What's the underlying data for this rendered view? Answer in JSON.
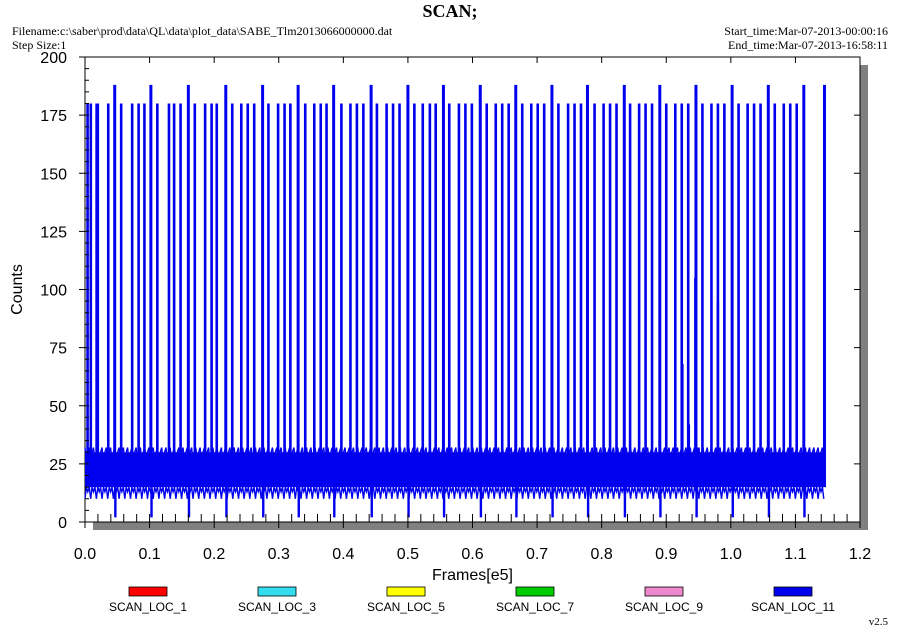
{
  "header": {
    "title": "SCAN;",
    "filename": "Filename:c:\\saber\\prod\\data\\QL\\data\\plot_data\\SABE_Tlm2013066000000.dat",
    "step_size": "Step Size:1",
    "start_time": "Start_time:Mar-07-2013-00:00:16",
    "end_time": "End_time:Mar-07-2013-16:58:11"
  },
  "footer": {
    "version": "v2.5"
  },
  "colors": {
    "plot_background": "#ffffff",
    "shadow": "#808080",
    "frame": "#000000",
    "primary_series": "#0000ee"
  },
  "chart_data": {
    "type": "line",
    "title": "SCAN;",
    "xlabel": "Frames[e5]",
    "ylabel": "Counts",
    "xlim": [
      0.0,
      1.2
    ],
    "ylim": [
      0,
      200
    ],
    "x_ticks": [
      0.0,
      0.1,
      0.2,
      0.3,
      0.4,
      0.5,
      0.6,
      0.7,
      0.8,
      0.9,
      1.0,
      1.1,
      1.2
    ],
    "x_tick_labels": [
      "0.0",
      "0.1",
      "0.2",
      "0.3",
      "0.4",
      "0.5",
      "0.6",
      "0.7",
      "0.8",
      "0.9",
      "1.0",
      "1.1",
      "1.2"
    ],
    "y_ticks": [
      0,
      25,
      50,
      75,
      100,
      125,
      150,
      175,
      200
    ],
    "y_tick_labels": [
      "0",
      "25",
      "50",
      "75",
      "100",
      "125",
      "150",
      "175",
      "200"
    ],
    "grid": false,
    "legend_position": "bottom",
    "data_extent_x": [
      0.0,
      1.145
    ],
    "baseline_band": {
      "low": 15,
      "high": 30
    },
    "high_spike_level": 180,
    "peak_spike_level": 188,
    "peak_spike_x": [
      0.046,
      0.102,
      0.16,
      0.218,
      0.275,
      0.33,
      0.385,
      0.443,
      0.5,
      0.555,
      0.612,
      0.667,
      0.723,
      0.778,
      0.835,
      0.89,
      0.946,
      1.002,
      1.058,
      1.113,
      1.145
    ],
    "high_spike_x": [
      0.004,
      0.009,
      0.018,
      0.036,
      0.056,
      0.073,
      0.083,
      0.092,
      0.112,
      0.13,
      0.138,
      0.148,
      0.17,
      0.186,
      0.196,
      0.204,
      0.228,
      0.242,
      0.252,
      0.262,
      0.284,
      0.299,
      0.309,
      0.318,
      0.341,
      0.355,
      0.365,
      0.374,
      0.397,
      0.411,
      0.421,
      0.431,
      0.452,
      0.467,
      0.477,
      0.487,
      0.51,
      0.523,
      0.534,
      0.543,
      0.564,
      0.579,
      0.589,
      0.599,
      0.622,
      0.636,
      0.646,
      0.656,
      0.677,
      0.691,
      0.701,
      0.711,
      0.733,
      0.748,
      0.758,
      0.768,
      0.789,
      0.803,
      0.813,
      0.823,
      0.844,
      0.858,
      0.868,
      0.878,
      0.9,
      0.914,
      0.924,
      0.934,
      0.956,
      0.97,
      0.98,
      0.99,
      1.012,
      1.026,
      1.036,
      1.046,
      1.068,
      1.082,
      1.092,
      1.102
    ],
    "short_spikes": [
      {
        "x": 0.02,
        "y": 180
      },
      {
        "x": 0.925,
        "y": 68
      },
      {
        "x": 0.935,
        "y": 42
      },
      {
        "x": 0.98,
        "y": 95
      },
      {
        "x": 0.945,
        "y": 105
      },
      {
        "x": 0.95,
        "y": 32
      }
    ],
    "dip_x": [
      0.047,
      0.103,
      0.161,
      0.219,
      0.276,
      0.331,
      0.386,
      0.444,
      0.501,
      0.556,
      0.613,
      0.668,
      0.724,
      0.779,
      0.836,
      0.891,
      0.947,
      1.003,
      1.059,
      1.114
    ],
    "dip_level": 2,
    "series": [
      {
        "name": "SCAN_LOC_1",
        "color": "#ff0000"
      },
      {
        "name": "SCAN_LOC_3",
        "color": "#33ddee"
      },
      {
        "name": "SCAN_LOC_5",
        "color": "#ffff00"
      },
      {
        "name": "SCAN_LOC_7",
        "color": "#00cc00"
      },
      {
        "name": "SCAN_LOC_9",
        "color": "#ee88cc"
      },
      {
        "name": "SCAN_LOC_11",
        "color": "#0000ee"
      }
    ]
  }
}
